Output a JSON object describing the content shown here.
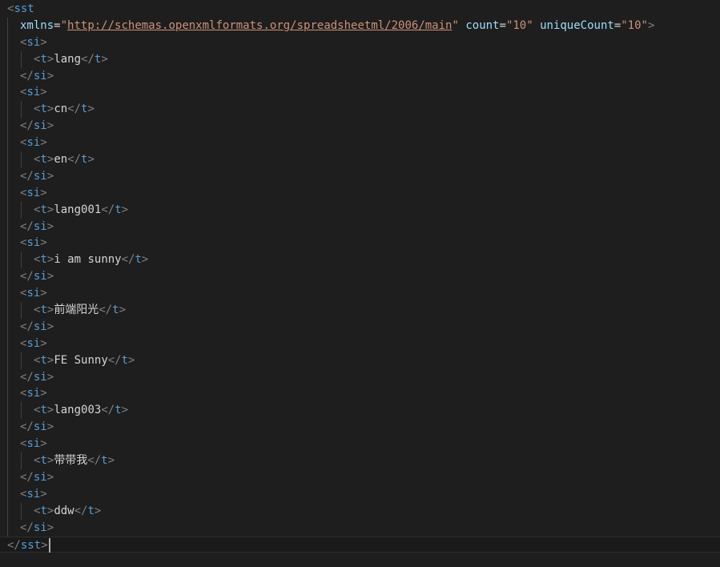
{
  "editor": {
    "root_tag": "sst",
    "xmlns_attr": "xmlns",
    "xmlns_value": "http://schemas.openxmlformats.org/spreadsheetml/2006/main",
    "count_attr": "count",
    "count_value": "10",
    "unique_attr": "uniqueCount",
    "unique_value": "10",
    "item_tag": "si",
    "text_tag": "t",
    "items": [
      "lang",
      "cn",
      "en",
      "lang001",
      "i am sunny",
      "前端阳光",
      "FE Sunny",
      "lang003",
      "带带我",
      "ddw"
    ]
  },
  "colors": {
    "background": "#1e1e1e",
    "tag": "#569cd6",
    "punctuation": "#808080",
    "attribute": "#9cdcfe",
    "string": "#ce9178",
    "text": "#d4d4d4"
  }
}
